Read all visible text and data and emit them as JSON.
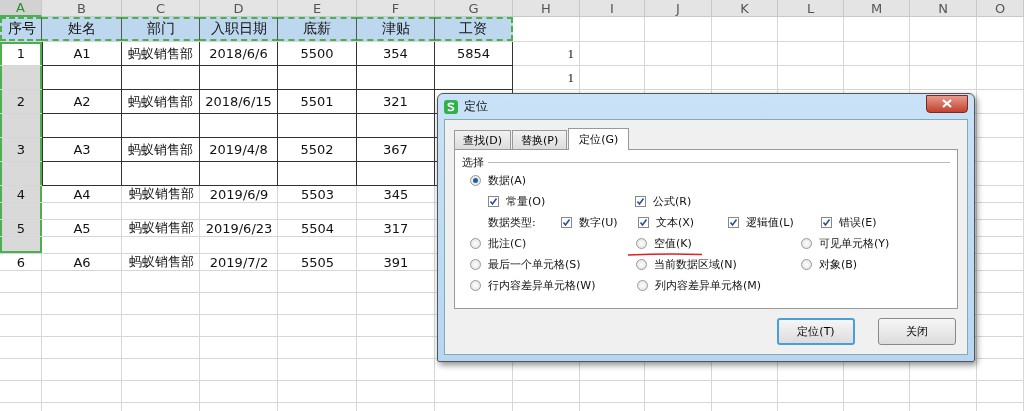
{
  "sheet": {
    "columns": [
      {
        "label": "A",
        "selected": true
      },
      {
        "label": "B",
        "selected": false
      },
      {
        "label": "C",
        "selected": false
      },
      {
        "label": "D",
        "selected": false
      },
      {
        "label": "E",
        "selected": false
      },
      {
        "label": "F",
        "selected": false
      },
      {
        "label": "G",
        "selected": false
      },
      {
        "label": "H",
        "selected": false
      },
      {
        "label": "I",
        "selected": false
      },
      {
        "label": "J",
        "selected": false
      },
      {
        "label": "K",
        "selected": false
      },
      {
        "label": "L",
        "selected": false
      },
      {
        "label": "M",
        "selected": false
      },
      {
        "label": "N",
        "selected": false
      },
      {
        "label": "O",
        "selected": false
      }
    ],
    "rows": [
      {
        "kind": "header",
        "cells": [
          "序号",
          "姓名",
          "部门",
          "入职日期",
          "底薪",
          "津贴",
          "工资"
        ]
      },
      {
        "kind": "data",
        "bordered": true,
        "selected": true,
        "active": true,
        "cells": [
          "1",
          "A1",
          "蚂蚁销售部",
          "2018/6/6",
          "5500",
          "354",
          "5854"
        ],
        "note": "1"
      },
      {
        "kind": "blank",
        "bordered": true,
        "selected": true,
        "active": false,
        "note": "1"
      },
      {
        "kind": "data",
        "bordered": true,
        "selected": true,
        "active": false,
        "cells": [
          "2",
          "A2",
          "蚂蚁销售部",
          "2018/6/15",
          "5501",
          "321"
        ]
      },
      {
        "kind": "blank",
        "bordered": true,
        "selected": true,
        "active": false
      },
      {
        "kind": "data",
        "bordered": true,
        "selected": true,
        "active": false,
        "cells": [
          "3",
          "A3",
          "蚂蚁销售部",
          "2019/4/8",
          "5502",
          "367"
        ]
      },
      {
        "kind": "blank",
        "bordered": true,
        "selected": true,
        "active": false
      },
      {
        "kind": "data",
        "bordered": false,
        "selected": true,
        "active": false,
        "cells": [
          "4",
          "A4",
          "蚂蚁销售部",
          "2019/6/9",
          "5503",
          "345"
        ]
      },
      {
        "kind": "blank",
        "bordered": false,
        "selected": true,
        "active": false
      },
      {
        "kind": "data",
        "bordered": false,
        "selected": true,
        "active": false,
        "cells": [
          "5",
          "A5",
          "蚂蚁销售部",
          "2019/6/23",
          "5504",
          "317"
        ]
      },
      {
        "kind": "blank",
        "bordered": false,
        "selected": true,
        "active": false
      },
      {
        "kind": "data",
        "bordered": false,
        "selected": false,
        "active": false,
        "cells": [
          "6",
          "A6",
          "蚂蚁销售部",
          "2019/7/2",
          "5505",
          "391"
        ]
      }
    ]
  },
  "dialog": {
    "title": "定位",
    "tabs": [
      {
        "label": "查找(D)",
        "selected": false
      },
      {
        "label": "替换(P)",
        "selected": false
      },
      {
        "label": "定位(G)",
        "selected": true
      }
    ],
    "group": "选择",
    "data_option": {
      "label": "数据(A)",
      "selected": true
    },
    "data_checks": [
      {
        "label": "常量(O)",
        "checked": true
      },
      {
        "label": "公式(R)",
        "checked": true
      }
    ],
    "type_label": "数据类型:",
    "type_checks": [
      {
        "label": "数字(U)",
        "checked": true
      },
      {
        "label": "文本(X)",
        "checked": true
      },
      {
        "label": "逻辑值(L)",
        "checked": true
      },
      {
        "label": "错误(E)",
        "checked": true
      }
    ],
    "options": [
      {
        "label": "批注(C)",
        "selected": false
      },
      {
        "label": "空值(K)",
        "selected": false,
        "highlighted": true
      },
      {
        "label": "可见单元格(Y)",
        "selected": false
      },
      {
        "label": "最后一个单元格(S)",
        "selected": false
      },
      {
        "label": "当前数据区域(N)",
        "selected": false
      },
      {
        "label": "对象(B)",
        "selected": false
      },
      {
        "label": "行内容差异单元格(W)",
        "selected": false
      },
      {
        "label": "列内容差异单元格(M)",
        "selected": false
      }
    ],
    "buttons": [
      {
        "label": "定位(T)",
        "default": true
      },
      {
        "label": "关闭",
        "default": false
      }
    ]
  }
}
